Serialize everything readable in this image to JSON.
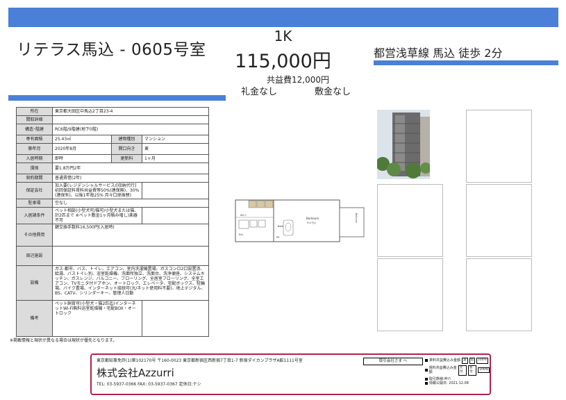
{
  "header": {
    "property_name": "リテラス馬込 - 0605号室",
    "layout": "1K",
    "rent": "115,000円",
    "kyoeki": "共益費12,000円",
    "reikin": "礼金なし",
    "shikikin": "敷金なし",
    "station": "都営浅草線 馬込 徒歩 2分"
  },
  "spec": {
    "address_label": "所在",
    "address": "東京都大田区中馬込2丁目23-4",
    "floor_detail_label": "間取詳細",
    "floor_detail": "",
    "structure_label": "構造･階建",
    "structure": "RC6階/9階建(地下0階)",
    "area_label": "専有面積",
    "area": "25.43㎡",
    "building_type_label": "建物種別",
    "building_type": "マンション",
    "built_label": "築年月",
    "built": "2020年8月",
    "direction_label": "開口向き",
    "direction": "東",
    "move_in_label": "入居時期",
    "move_in": "即時",
    "renewal_label": "更新料",
    "renewal": "1ヶ月",
    "deposit_label": "損保",
    "deposit": "要1.8万円2年",
    "contract_label": "契約期間",
    "contract": "普通賃借(2年)",
    "guarantor_label": "保証会社",
    "guarantor": "加入要(レジデンシャルサービス/[収納代行]初回保証料賃料共益費等50%(連保無)、30%(連保有)、以後1年毎25% 月々口座振替)",
    "parking_label": "駐車場",
    "parking": "空なし",
    "conditions_label": "入居諸条件",
    "conditions": "ペット相談(小型犬可/猫可/小型犬または猫、計2匹まで ※ペット敷金1ヶ月積み増し)楽器不可",
    "other_cost_label": "その他費用",
    "other_cost": "鍵交換手数料16,500円(入居時)",
    "surroundings_label": "周辺施設",
    "surroundings": "",
    "facilities_label": "設備",
    "facilities": "ガス:都市、バス、トイレ、エアコン、室内洗濯機置場、ガスコンロ2口設置済、給湯、バストイレ別、浴室乾燥機、洗面所独立、洗面台、洗浄便座、システムキッチン、ガスレンジ、バルコニー、フローリング、全居室フローリング、全室エアコン、TVモニタ付ドアホン、オートロック、エレベータ、宅配ボックス、駐輪場、バイク置場、インターネット接続可(光/ネット使用料不要)、地上デジタル、BS、CATV、シリンダーキー、管理人日勤",
    "remarks_label": "備考",
    "remarks": "ペット飼育可(小型犬・猫2匹迄)インターネットWi-Fi無料浴室乾燥機・宅配BOX・オートロック"
  },
  "floorplan": {
    "bedroom": "Bedroom",
    "bedroom_size": "9.4ｆ(J)",
    "balcony": "Balcony",
    "bath": "Bath",
    "ent": "Ent.",
    "wic": "W.I.C",
    "ps": "PS"
  },
  "note": "※掲載情報と現状が異なる場合は現状が優先となります。",
  "footer": {
    "address": "東京都知事免許(1)第102170号 〒160-0023 東京都新宿区西新宿7丁目1-7 新宿ダイカンプラザA館1111号室",
    "company": "株式会社Azzurri",
    "tel": "TEL: 03-5937-0366 FAX: 03-5937-0367 定休日:ナシ",
    "stamp": "取引会社さま へ",
    "fee1_label": "賃料共益費込み金額",
    "fee1_a": "貸",
    "fee1_b": "借",
    "fee1_val": "100%",
    "fee2_label": "賃料共益費込み金額",
    "fee2_a": "元付",
    "fee2_b": "客付",
    "fee2_val": "100%",
    "form": "取引態様:仲介",
    "updated": "情報公開日: 2021.12.08"
  }
}
